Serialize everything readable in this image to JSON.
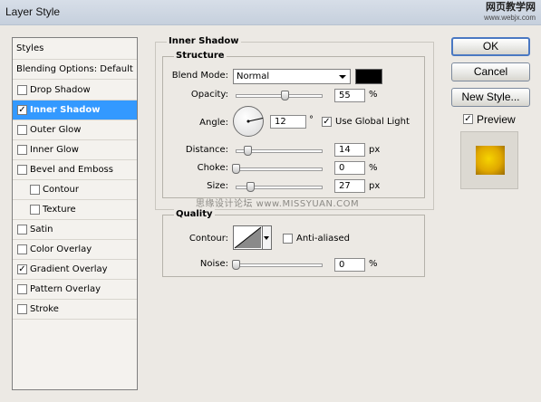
{
  "window": {
    "title": "Layer Style",
    "watermark_top": "网页教学网",
    "watermark_bottom": "www.webjx.com",
    "center_watermark": "思缘设计论坛 www.MISSYUAN.COM"
  },
  "styles_list": {
    "header": "Styles",
    "blending": "Blending Options: Default",
    "items": [
      {
        "label": "Drop Shadow",
        "checked": false
      },
      {
        "label": "Inner Shadow",
        "checked": true,
        "selected": true
      },
      {
        "label": "Outer Glow",
        "checked": false
      },
      {
        "label": "Inner Glow",
        "checked": false
      },
      {
        "label": "Bevel and Emboss",
        "checked": false
      },
      {
        "label": "Contour",
        "checked": false
      },
      {
        "label": "Texture",
        "checked": false
      },
      {
        "label": "Satin",
        "checked": false
      },
      {
        "label": "Color Overlay",
        "checked": false
      },
      {
        "label": "Gradient Overlay",
        "checked": true
      },
      {
        "label": "Pattern Overlay",
        "checked": false
      },
      {
        "label": "Stroke",
        "checked": false
      }
    ]
  },
  "panel": {
    "title": "Inner Shadow",
    "structure": {
      "title": "Structure",
      "blend_mode_label": "Blend Mode:",
      "blend_mode_value": "Normal",
      "shadow_color": "#000000",
      "opacity_label": "Opacity:",
      "opacity_value": "55",
      "opacity_unit": "%",
      "angle_label": "Angle:",
      "angle_value": "12",
      "angle_unit": "°",
      "use_global_light_label": "Use Global Light",
      "use_global_light_checked": true,
      "distance_label": "Distance:",
      "distance_value": "14",
      "distance_unit": "px",
      "choke_label": "Choke:",
      "choke_value": "0",
      "choke_unit": "%",
      "size_label": "Size:",
      "size_value": "27",
      "size_unit": "px"
    },
    "quality": {
      "title": "Quality",
      "contour_label": "Contour:",
      "anti_aliased_label": "Anti-aliased",
      "anti_aliased_checked": false,
      "noise_label": "Noise:",
      "noise_value": "0",
      "noise_unit": "%"
    }
  },
  "buttons": {
    "ok": "OK",
    "cancel": "Cancel",
    "new_style": "New Style...",
    "preview_label": "Preview",
    "preview_checked": true
  }
}
